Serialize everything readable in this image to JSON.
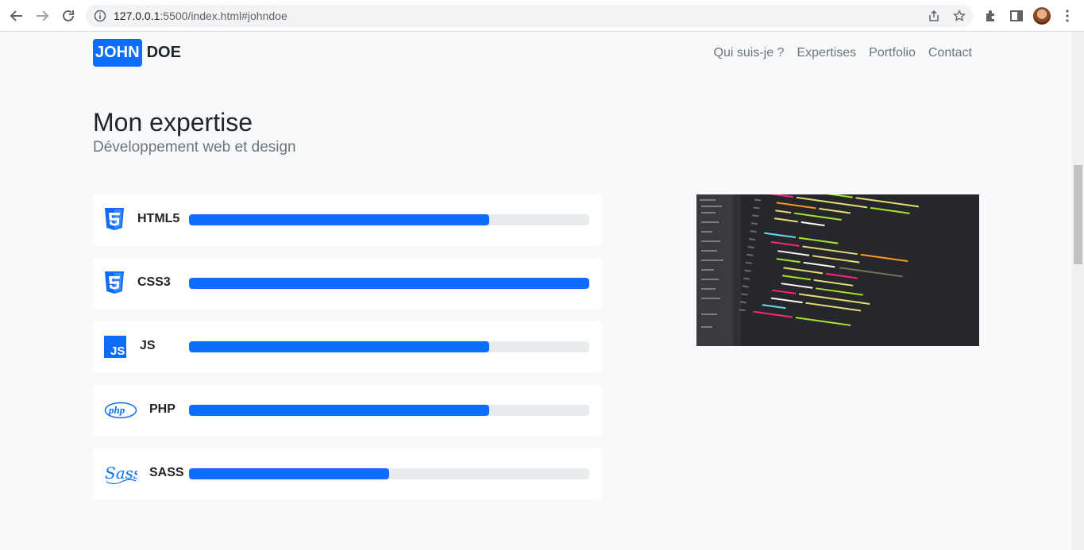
{
  "browser": {
    "url_host": "127.0.0.1",
    "url_rest": ":5500/index.html#johndoe"
  },
  "nav": {
    "brand_part1": "JOHN",
    "brand_part2": "DOE",
    "links": [
      "Qui suis-je ?",
      "Expertises",
      "Portfolio",
      "Contact"
    ]
  },
  "section": {
    "title": "Mon expertise",
    "subtitle": "Développement web et design"
  },
  "skills": [
    {
      "name": "HTML5",
      "icon": "html5-icon",
      "level": 0.75
    },
    {
      "name": "CSS3",
      "icon": "css3-icon",
      "level": 1.0
    },
    {
      "name": "JS",
      "icon": "js-icon",
      "level": 0.75
    },
    {
      "name": "PHP",
      "icon": "php-icon",
      "level": 0.75
    },
    {
      "name": "SASS",
      "icon": "sass-icon",
      "level": 0.5
    }
  ],
  "colors": {
    "accent": "#0d6efd",
    "track": "#e9ecef",
    "background": "#f8f9fa"
  }
}
